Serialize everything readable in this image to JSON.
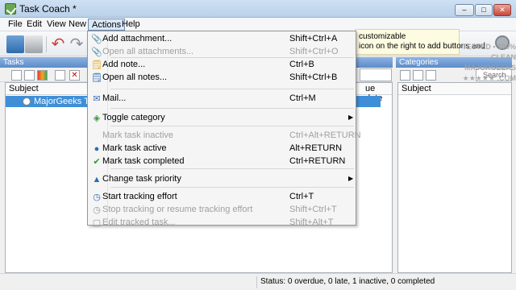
{
  "window": {
    "title": "Task Coach *",
    "min": "–",
    "max": "□",
    "close": "✕"
  },
  "menubar": [
    "File",
    "Edit",
    "View",
    "New",
    "Actions",
    "Help"
  ],
  "hint": {
    "line1": "customizable",
    "line2": "icon on the right to add buttons and"
  },
  "tasks": {
    "header": "Tasks",
    "col_subject": "Subject",
    "col_due": "ue date",
    "row_label": "MajorGeeks Test"
  },
  "categories": {
    "header": "Categories",
    "search_placeholder": "Search",
    "col_subject": "Subject"
  },
  "watermark": {
    "line1": "TESTED • 100% CLEAN",
    "line2": "MAJORGEEKS",
    "line3": "★★★★★ .COM"
  },
  "status": "Status: 0 overdue, 0 late, 1 inactive, 0 completed",
  "actions_menu": {
    "items": [
      {
        "label": "Add attachment...",
        "shortcut": "Shift+Ctrl+A",
        "icon": "paperclip-icon",
        "glyph": "📎",
        "disabled": false
      },
      {
        "label": "Open all attachments...",
        "shortcut": "Shift+Ctrl+O",
        "icon": "paperclip-open-icon",
        "glyph": "📎",
        "disabled": true
      },
      {
        "label": "Add note...",
        "shortcut": "Ctrl+B",
        "icon": "note-icon",
        "glyph": "🗒",
        "disabled": false
      },
      {
        "label": "Open all notes...",
        "shortcut": "Shift+Ctrl+B",
        "icon": "notes-icon",
        "glyph": "🗒",
        "disabled": false
      },
      {
        "label": "Mail...",
        "shortcut": "Ctrl+M",
        "icon": "mail-icon",
        "glyph": "✉",
        "disabled": false
      },
      {
        "label": "Toggle category",
        "shortcut": "",
        "icon": "category-icon",
        "glyph": "◈",
        "disabled": false,
        "submenu": true
      },
      {
        "label": "Mark task inactive",
        "shortcut": "Ctrl+Alt+RETURN",
        "icon": "",
        "glyph": "",
        "disabled": true
      },
      {
        "label": "Mark task active",
        "shortcut": "Alt+RETURN",
        "icon": "circle-icon",
        "glyph": "●",
        "disabled": false
      },
      {
        "label": "Mark task completed",
        "shortcut": "Ctrl+RETURN",
        "icon": "check-icon",
        "glyph": "✔",
        "disabled": false
      },
      {
        "label": "Change task priority",
        "shortcut": "",
        "icon": "priority-icon",
        "glyph": "▲",
        "disabled": false,
        "submenu": true
      },
      {
        "label": "Start tracking effort",
        "shortcut": "Ctrl+T",
        "icon": "clock-icon",
        "glyph": "◷",
        "disabled": false
      },
      {
        "label": "Stop tracking or resume tracking effort",
        "shortcut": "Shift+Ctrl+T",
        "icon": "stop-clock-icon",
        "glyph": "◷",
        "disabled": true
      },
      {
        "label": "Edit tracked task...",
        "shortcut": "Shift+Alt+T",
        "icon": "edit-icon",
        "glyph": "▢",
        "disabled": true
      }
    ]
  },
  "colors": {
    "accent": "#3f8fd8",
    "header": "#5b8cc8"
  }
}
